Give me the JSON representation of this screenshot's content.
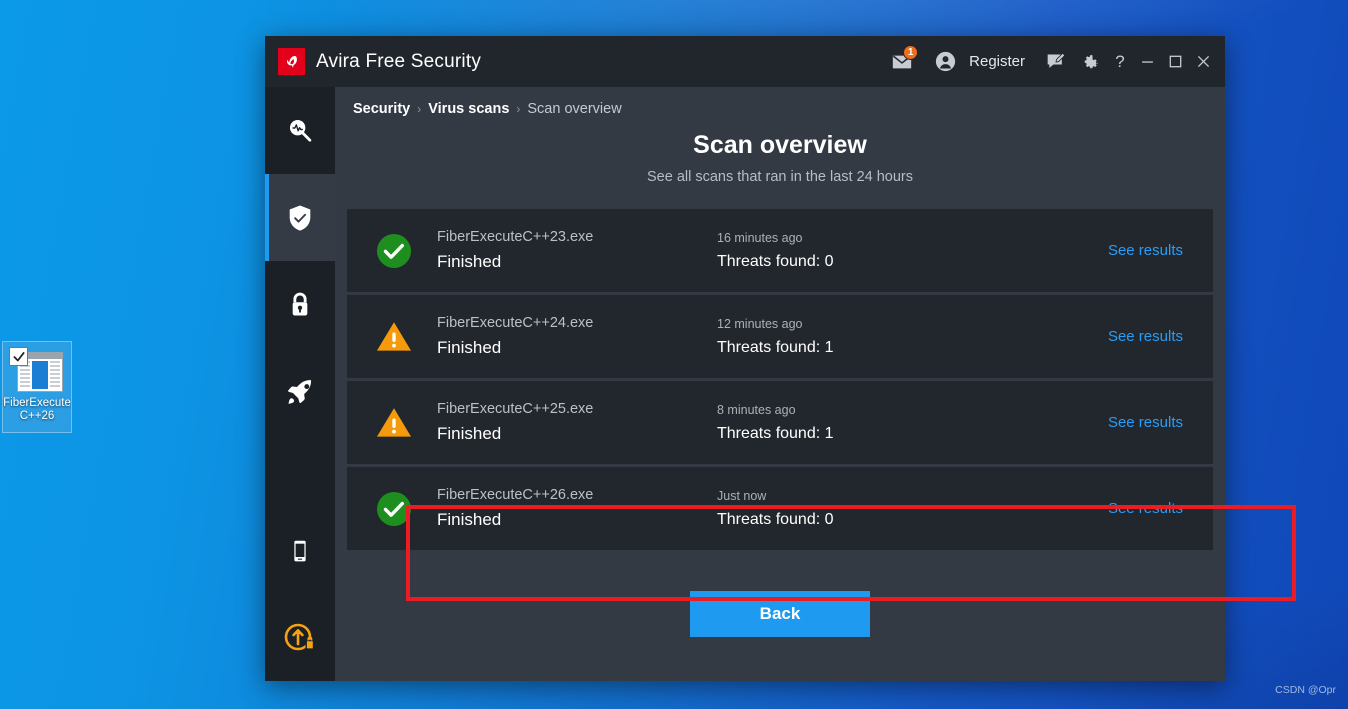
{
  "desktop": {
    "icon": {
      "name": "FiberExecute",
      "label_line1": "FiberExecute",
      "label_line2": "C++26",
      "overlay": "checkmark-badge"
    },
    "watermark": "CSDN @Opr"
  },
  "window": {
    "brand_name": "Avira",
    "brand_product": "Free Security",
    "logo_icon": "avira-logo-icon",
    "titlebar": {
      "mail_icon": "mail-icon",
      "mail_badge": "1",
      "account_icon": "account-icon",
      "register_label": "Register",
      "feedback_icon": "feedback-icon",
      "settings_icon": "gear-icon",
      "help_label": "?",
      "minimize_icon": "minimize-icon",
      "maximize_icon": "maximize-icon",
      "close_icon": "close-icon"
    }
  },
  "sidebar": {
    "items": [
      {
        "icon": "scan-magnifier-icon",
        "name": "smart-scan",
        "active": false
      },
      {
        "icon": "shield-check-icon",
        "name": "security",
        "active": true
      },
      {
        "icon": "lock-icon",
        "name": "privacy",
        "active": false
      },
      {
        "icon": "rocket-icon",
        "name": "performance",
        "active": false
      },
      {
        "icon": "mobile-device-icon",
        "name": "devices",
        "active": false
      },
      {
        "icon": "upgrade-bag-icon",
        "name": "upgrade",
        "active": false
      }
    ]
  },
  "main": {
    "breadcrumb": [
      "Security",
      "Virus scans",
      "Scan overview"
    ],
    "breadcrumb_separator": "›",
    "title": "Scan overview",
    "subtitle": "See all scans that ran in the last 24 hours",
    "link_label": "See results",
    "back_label": "Back",
    "scans": [
      {
        "status": "ok",
        "status_icon": "green-check-circle-icon",
        "file": "FiberExecuteC++23.exe",
        "state": "Finished",
        "time": "16 minutes ago",
        "threats": "Threats found: 0",
        "link": "See results",
        "highlighted": false
      },
      {
        "status": "warning",
        "status_icon": "orange-warning-triangle-icon",
        "file": "FiberExecuteC++24.exe",
        "state": "Finished",
        "time": "12 minutes ago",
        "threats": "Threats found: 1",
        "link": "See results",
        "highlighted": false
      },
      {
        "status": "warning",
        "status_icon": "orange-warning-triangle-icon",
        "file": "FiberExecuteC++25.exe",
        "state": "Finished",
        "time": "8 minutes ago",
        "threats": "Threats found: 1",
        "link": "See results",
        "highlighted": false
      },
      {
        "status": "ok",
        "status_icon": "green-check-circle-icon",
        "file": "FiberExecuteC++26.exe",
        "state": "Finished",
        "time": "Just now",
        "threats": "Threats found: 0",
        "link": "See results",
        "highlighted": true
      }
    ]
  },
  "colors": {
    "accent_blue": "#1e9bf0",
    "link_blue": "#2a9df4",
    "brand_red": "#e3001b",
    "badge_orange": "#ef6c1a",
    "status_ok_green": "#1e8f1e",
    "status_warn_orange": "#f59a0b",
    "highlight_red": "#ec1c24",
    "window_bg": "#333a44",
    "titlebar_bg": "#20262c",
    "sidebar_bg": "#1b2026",
    "row_bg": "#22272e"
  }
}
